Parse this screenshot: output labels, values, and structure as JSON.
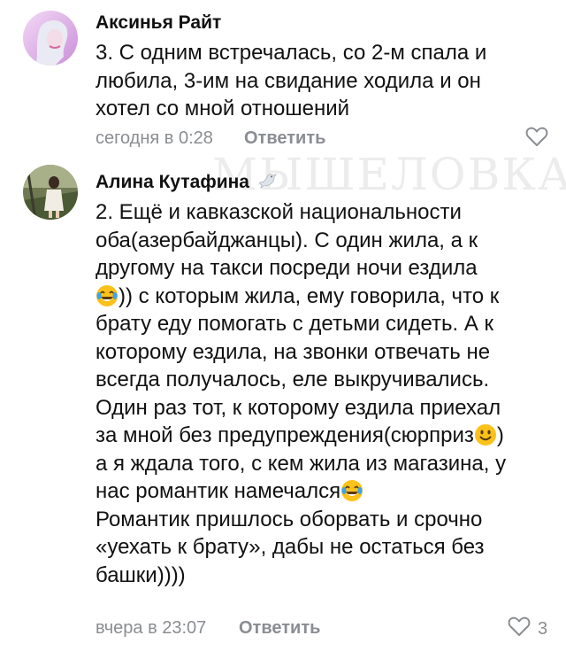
{
  "watermark": "МЫШЕЛОВКА",
  "comments": [
    {
      "author": "Аксинья Райт",
      "lines": [
        "3. С одним встречалась, со 2-м спала и",
        "любила, 3-им на свидание ходила и он",
        "хотел со мной отношений"
      ],
      "time": "сегодня в 0:28",
      "reply_label": "Ответить",
      "like_count": ""
    },
    {
      "author": "Алина Кутафина",
      "author_badge_icon": "dove-icon",
      "lines": [
        "2. Ещё и кавказской национальности",
        "оба(азербайджанцы). С один жила, а к",
        "другому на такси посреди ночи ездила",
        ")) с которым жила, ему говорила, что к",
        "брату еду помогать с детьми сидеть. А к",
        "которому ездила, на звонки отвечать не",
        "всегда получалось, еле выкручивались.",
        "Один раз тот, к которому ездила приехал",
        "за мной без предупреждения(сюрприз",
        "а я ждала того, с кем жила из магазина, у",
        "нас романтик намечался",
        "Романтик пришлось оборвать и срочно",
        "«уехать к брату», дабы не остаться без",
        "башки))))"
      ],
      "line_end_after_emoji": ")",
      "time": "вчера в 23:07",
      "reply_label": "Ответить",
      "like_count": "3"
    }
  ],
  "icons": {
    "like": "heart-outline-icon",
    "laugh": "face-with-tears-of-joy-icon",
    "smile": "slightly-smiling-face-icon"
  },
  "colors": {
    "meta_gray": "#8a8d91",
    "text": "#111111"
  }
}
